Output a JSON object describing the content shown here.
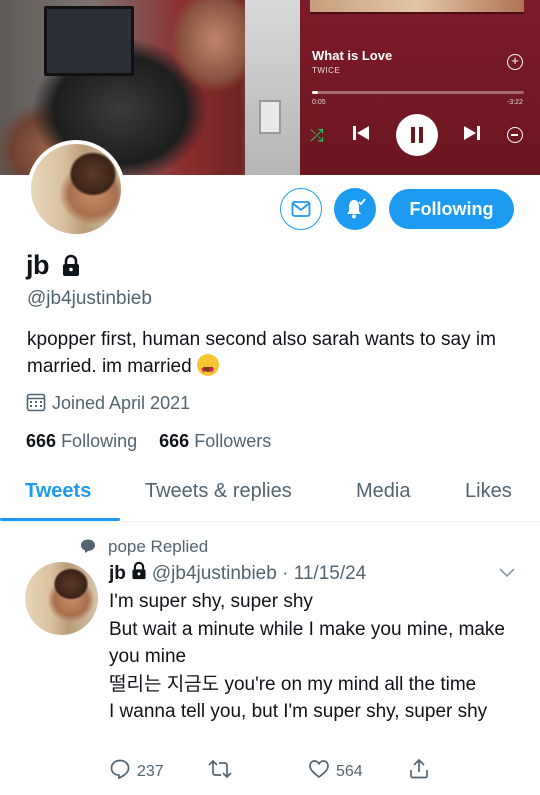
{
  "player": {
    "song_title": "What is Love",
    "artist": "TWICE",
    "elapsed": "0:05",
    "remaining": "-3:22",
    "progress_fraction": 0.03
  },
  "profile": {
    "display_name": "jb",
    "handle": "@jb4justinbieb",
    "bio": "kpopper first, human second also sarah wants to say im married. im married",
    "joined": "Joined April 2021",
    "following_count": "666",
    "following_label": "Following",
    "followers_count": "666",
    "followers_label": "Followers",
    "follow_button_label": "Following"
  },
  "tabs": [
    {
      "label": "Tweets",
      "active": true
    },
    {
      "label": "Tweets & replies",
      "active": false
    },
    {
      "label": "Media",
      "active": false
    },
    {
      "label": "Likes",
      "active": false
    }
  ],
  "tweet": {
    "context": "pope Replied",
    "author_name": "jb",
    "author_handle": "@jb4justinbieb",
    "date": "11/15/24",
    "lines": [
      "I'm super shy, super shy",
      "But wait a minute while I make you mine, make you mine",
      "떨리는 지금도 you're on my mind all the time",
      "I wanna tell you, but I'm super shy, super shy"
    ],
    "replies": "237",
    "retweets": "",
    "likes": "564"
  },
  "colors": {
    "accent": "#1d9bf0",
    "text_secondary": "#536471",
    "player_bg": "#7e1b28",
    "shuffle_green": "#1ed760"
  },
  "icons": [
    "mail-icon",
    "bell-icon",
    "lock-icon",
    "calendar-icon",
    "reply-icon",
    "retweet-icon",
    "like-icon",
    "share-icon",
    "chevron-down-icon",
    "shuffle-icon",
    "previous-icon",
    "pause-icon",
    "next-icon",
    "add-icon",
    "remove-icon"
  ]
}
